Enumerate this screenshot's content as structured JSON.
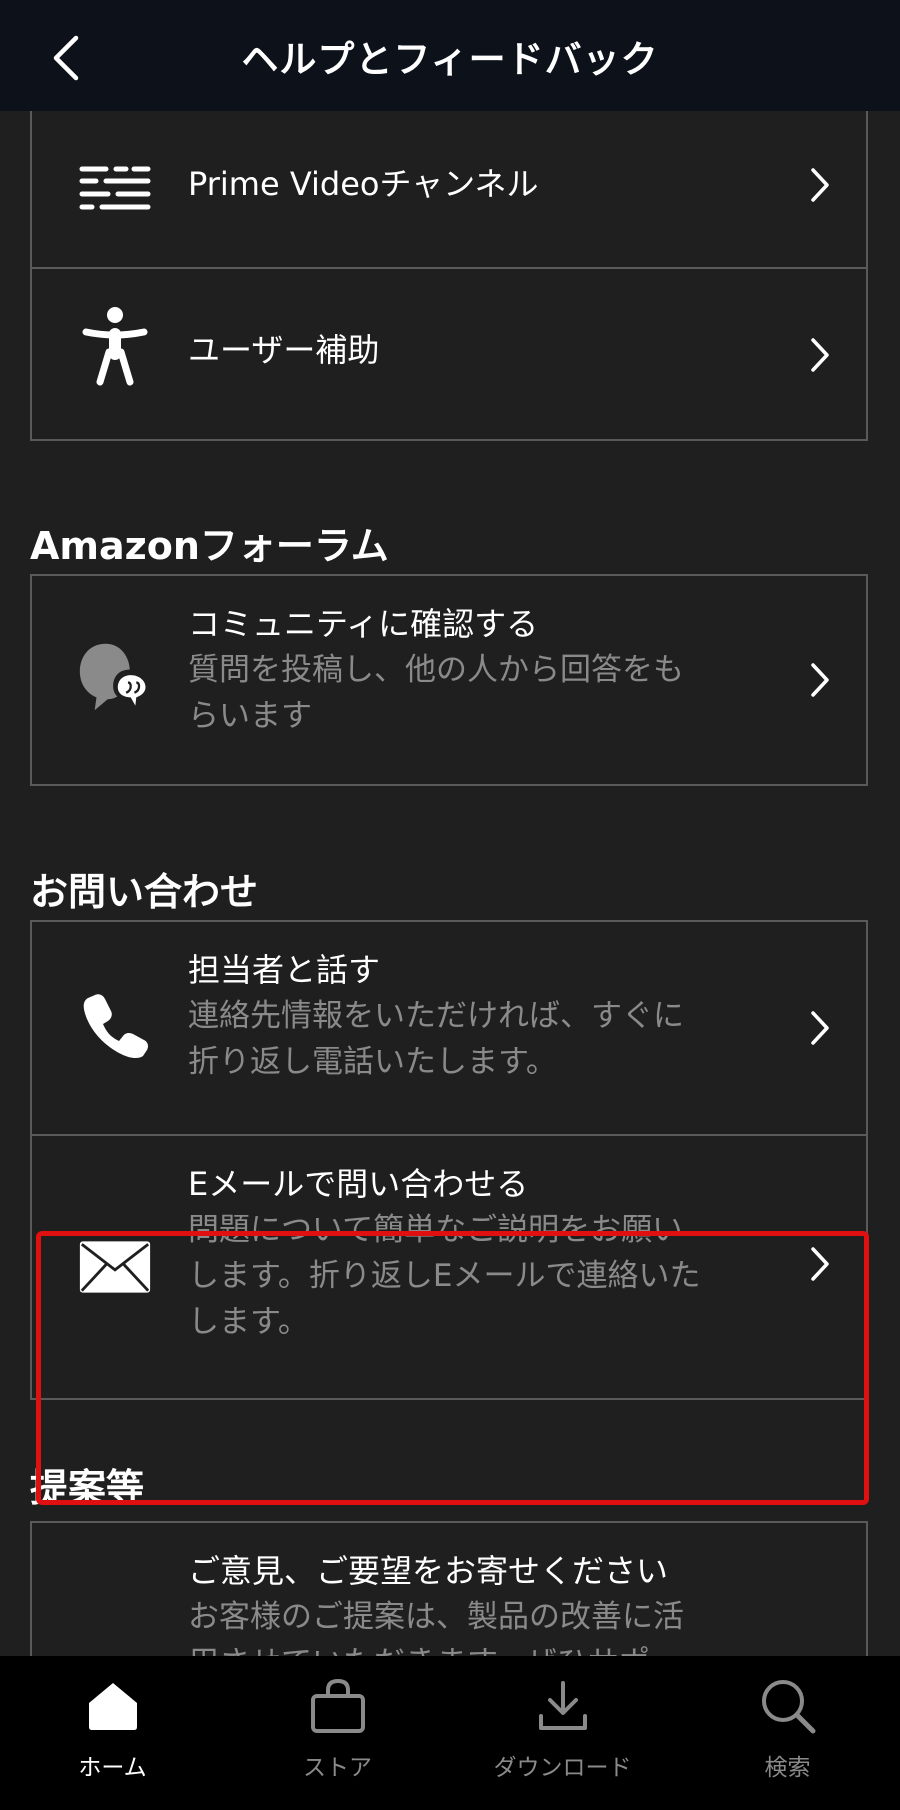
{
  "header": {
    "title": "ヘルプとフィードバック"
  },
  "top_card": {
    "items": [
      {
        "label": "Prime Videoチャンネル"
      },
      {
        "label": "ユーザー補助"
      }
    ]
  },
  "sections": {
    "forum": {
      "title": "Amazonフォーラム",
      "item": {
        "label": "コミュニティに確認する",
        "sub1": "質問を投稿し、他の人から回答をも",
        "sub2": "らいます"
      }
    },
    "contact": {
      "title": "お問い合わせ",
      "phone": {
        "label": "担当者と話す",
        "sub1": "連絡先情報をいただければ、すぐに",
        "sub2": "折り返し電話いたします。"
      },
      "email": {
        "label": "Eメールで問い合わせる",
        "sub1": "問題について簡単なご説明をお願い",
        "sub2": "します。折り返しEメールで連絡いた",
        "sub3": "します。"
      }
    },
    "feedback": {
      "title": "提案等",
      "item": {
        "label": "ご意見、ご要望をお寄せください",
        "sub1": "お客様のご提案は、製品の改善に活",
        "sub2": "用させていただきます。ぜひサポ"
      }
    }
  },
  "tabs": [
    {
      "label": "ホーム",
      "active": true
    },
    {
      "label": "ストア"
    },
    {
      "label": "ダウンロード"
    },
    {
      "label": "検索"
    }
  ],
  "colors": {
    "highlight": "#e01010",
    "background": "#1f1f1f",
    "header": "#0c111a"
  }
}
